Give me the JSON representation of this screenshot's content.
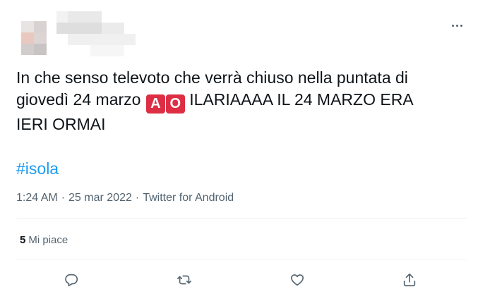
{
  "tweet": {
    "text_line1": "In che senso televoto che verrà chiuso nella puntata di",
    "text_line2_before": "giovedì 24 marzo",
    "emoji_a": "A",
    "emoji_o": "O",
    "text_line2_after": "ILARIAAAA IL 24 MARZO ERA",
    "text_line3": "IERI ORMAI",
    "hashtag": "#isola",
    "time": "1:24 AM",
    "date": "25 mar 2022",
    "source": "Twitter for Android",
    "likes_count": "5",
    "likes_label": "Mi piace"
  },
  "colors": {
    "accent": "#1d9bf0",
    "emoji_red": "#dd2e44",
    "muted": "#536471"
  },
  "icons": [
    "more-icon",
    "reply-icon",
    "retweet-icon",
    "like-icon",
    "share-icon"
  ]
}
